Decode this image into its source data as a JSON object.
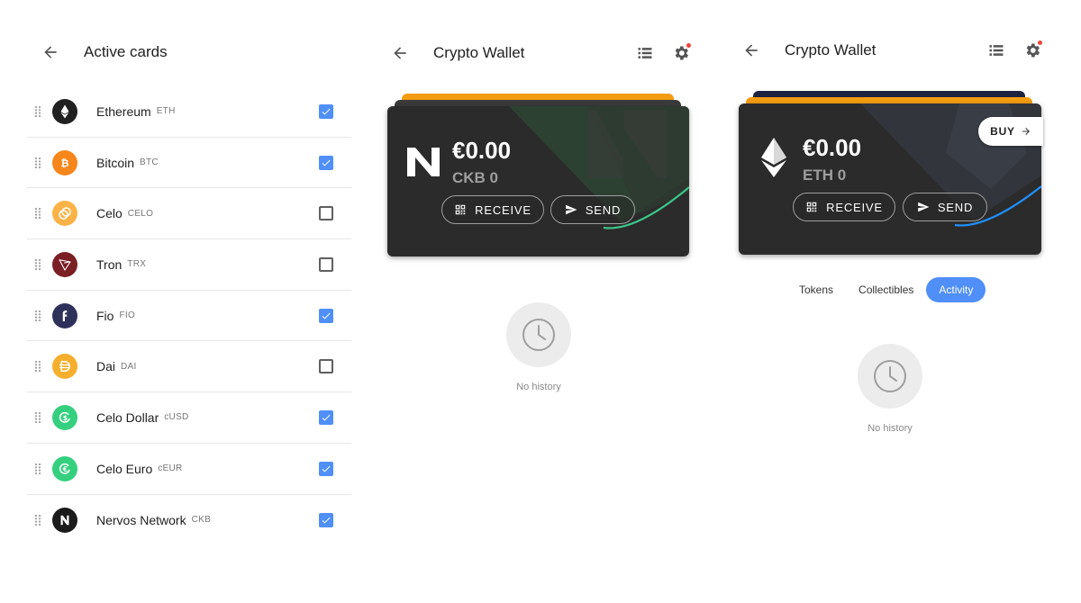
{
  "active_cards": {
    "title": "Active cards",
    "items": [
      {
        "name": "Ethereum",
        "symbol": "ETH",
        "checked": true,
        "color": "#212121",
        "icon": "ethereum-icon"
      },
      {
        "name": "Bitcoin",
        "symbol": "BTC",
        "checked": true,
        "color": "#f7861b",
        "icon": "bitcoin-icon"
      },
      {
        "name": "Celo",
        "symbol": "CELO",
        "checked": false,
        "color": "#fbb246",
        "icon": "celo-icon"
      },
      {
        "name": "Tron",
        "symbol": "TRX",
        "checked": false,
        "color": "#7a1f24",
        "icon": "tron-icon"
      },
      {
        "name": "Fio",
        "symbol": "FIO",
        "checked": true,
        "color": "#30315a",
        "icon": "fio-icon"
      },
      {
        "name": "Dai",
        "symbol": "DAI",
        "checked": false,
        "color": "#f6ae2d",
        "icon": "dai-icon"
      },
      {
        "name": "Celo Dollar",
        "symbol": "cUSD",
        "checked": true,
        "color": "#35d07f",
        "icon": "celo-dollar-icon"
      },
      {
        "name": "Celo Euro",
        "symbol": "cEUR",
        "checked": true,
        "color": "#35d07f",
        "icon": "celo-euro-icon"
      },
      {
        "name": "Nervos Network",
        "symbol": "CKB",
        "checked": true,
        "color": "#1b1b1b",
        "icon": "nervos-icon"
      }
    ]
  },
  "wallet_ckb": {
    "title": "Crypto Wallet",
    "amount": "€0.00",
    "balance": "CKB 0",
    "receive_label": "RECEIVE",
    "send_label": "SEND",
    "empty_text": "No history"
  },
  "wallet_eth": {
    "title": "Crypto Wallet",
    "amount": "€0.00",
    "balance": "ETH 0",
    "receive_label": "RECEIVE",
    "send_label": "SEND",
    "buy_label": "BUY",
    "tabs": [
      {
        "label": "Tokens",
        "active": false
      },
      {
        "label": "Collectibles",
        "active": false
      },
      {
        "label": "Activity",
        "active": true
      }
    ],
    "empty_text": "No history"
  },
  "colors": {
    "accent": "#4f8ff7",
    "card": "#2b2b2b",
    "notification": "#f44336",
    "stack_orange": "#f39c12",
    "ckb_glow": "#3cc68a",
    "eth_glow": "#1e90ff"
  }
}
